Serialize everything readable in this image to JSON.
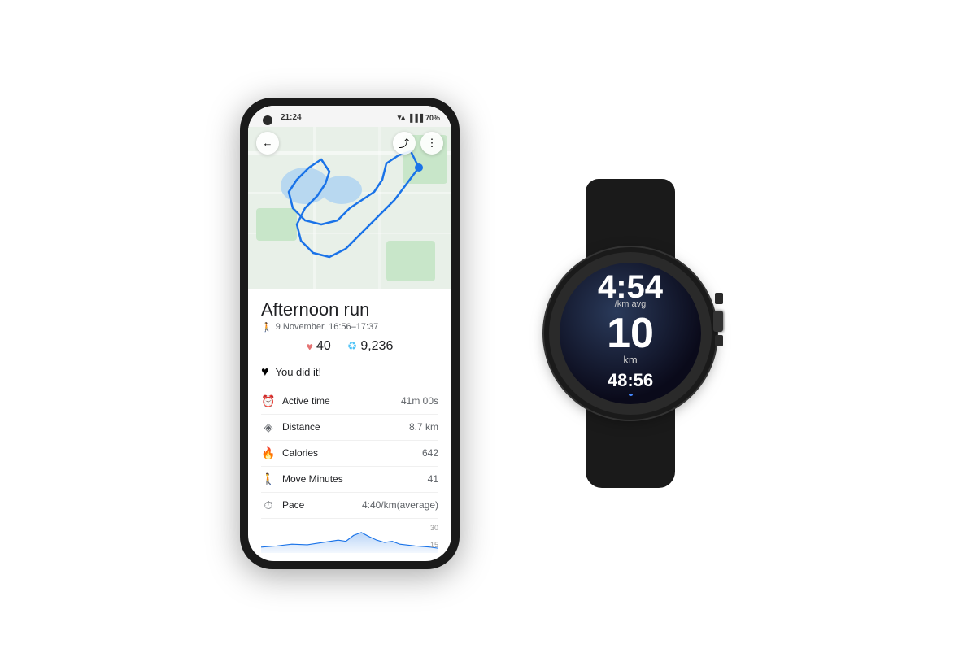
{
  "phone": {
    "status": {
      "time": "21:24",
      "battery": "70%",
      "signal_icon": "▲",
      "wifi_icon": "▼",
      "battery_icon": "🔋"
    },
    "toolbar": {
      "back": "←",
      "share": "⤴",
      "more": "⋮"
    },
    "activity": {
      "title": "Afternoon run",
      "date": "9 November, 16:56–17:37",
      "date_icon": "🚶",
      "points_heart": "40",
      "points_steps": "9,236",
      "achievement": "You did it!",
      "active_time_label": "Active time",
      "active_time_value": "41m 00s"
    },
    "stats": [
      {
        "icon": "◈",
        "label": "Distance",
        "value": "8.7 km"
      },
      {
        "icon": "🔥",
        "label": "Calories",
        "value": "642"
      },
      {
        "icon": "🚶",
        "label": "Move Minutes",
        "value": "41"
      },
      {
        "icon": "⏱",
        "label": "Pace",
        "value": "4:40/km(average)"
      }
    ],
    "chart": {
      "label_top": "30",
      "label_bottom": "15"
    }
  },
  "watch": {
    "pace": "4:54",
    "pace_label": "/km avg",
    "distance": "10",
    "distance_unit": "km",
    "time": "48:56"
  }
}
